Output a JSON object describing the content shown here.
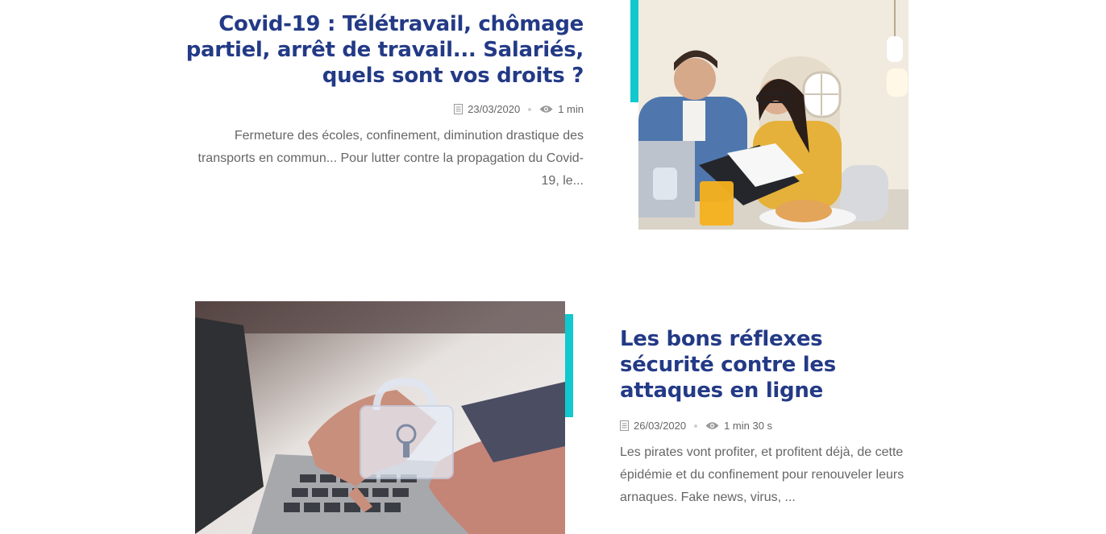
{
  "articles": [
    {
      "title": "Covid-19 : Télétravail, chômage partiel, arrêt de travail... Salariés, quels sont vos droits ?",
      "date": "23/03/2020",
      "read_time": "1 min",
      "excerpt": "Fermeture des écoles, confinement, diminution drastique des transports en commun... Pour lutter contre la propagation du Covid-19, le...",
      "image_alt": "couple-reviewing-documents-photo"
    },
    {
      "title": "Les bons réflexes sécurité contre les attaques en ligne",
      "date": "26/03/2020",
      "read_time": "1 min 30 s",
      "excerpt": "Les pirates vont profiter, et profitent déjà, de cette épidémie et du confinement pour renouveler leurs arnaques. Fake news, virus, ...",
      "image_alt": "laptop-padlock-photo"
    }
  ],
  "icons": {
    "date": "document-icon",
    "views": "eye-icon"
  },
  "colors": {
    "title": "#233a86",
    "accent": "#11c8cf",
    "text": "#666666"
  }
}
